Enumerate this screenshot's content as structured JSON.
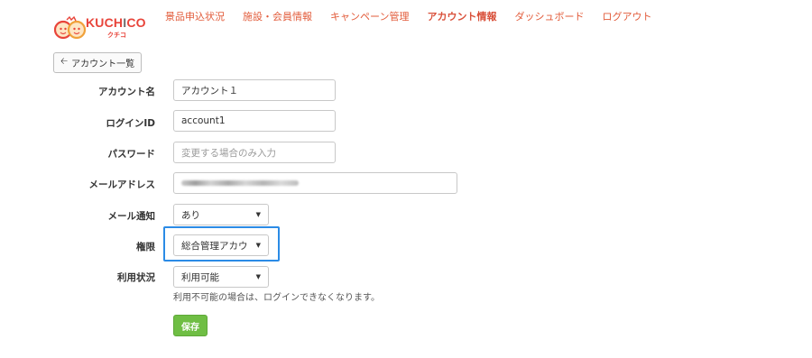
{
  "logo": {
    "text_red": "KUCH",
    "text_gray": "I",
    "text_red2": "CO",
    "sub": "クチコ"
  },
  "nav": [
    {
      "label": "景品申込状況"
    },
    {
      "label": "施設・会員情報"
    },
    {
      "label": "キャンペーン管理"
    },
    {
      "label": "アカウント情報",
      "active": true
    },
    {
      "label": "ダッシュボード"
    },
    {
      "label": "ログアウト"
    }
  ],
  "back_button": {
    "label": "アカウント一覧"
  },
  "form": {
    "account_name": {
      "label": "アカウント名",
      "value": "アカウント１"
    },
    "login_id": {
      "label": "ログインID",
      "value": "account1"
    },
    "password": {
      "label": "パスワード",
      "placeholder": "変更する場合のみ入力"
    },
    "email": {
      "label": "メールアドレス"
    },
    "mail_notify": {
      "label": "メール通知",
      "value": "あり"
    },
    "authority": {
      "label": "権限",
      "value": "総合管理アカウ"
    },
    "usage_status": {
      "label": "利用状況",
      "value": "利用可能",
      "help": "利用不可能の場合は、ログインできなくなります。"
    }
  },
  "save_button": {
    "label": "保存"
  },
  "colors": {
    "accent": "#e25b3a",
    "highlight": "#2b8be6",
    "save": "#6fbe44"
  }
}
